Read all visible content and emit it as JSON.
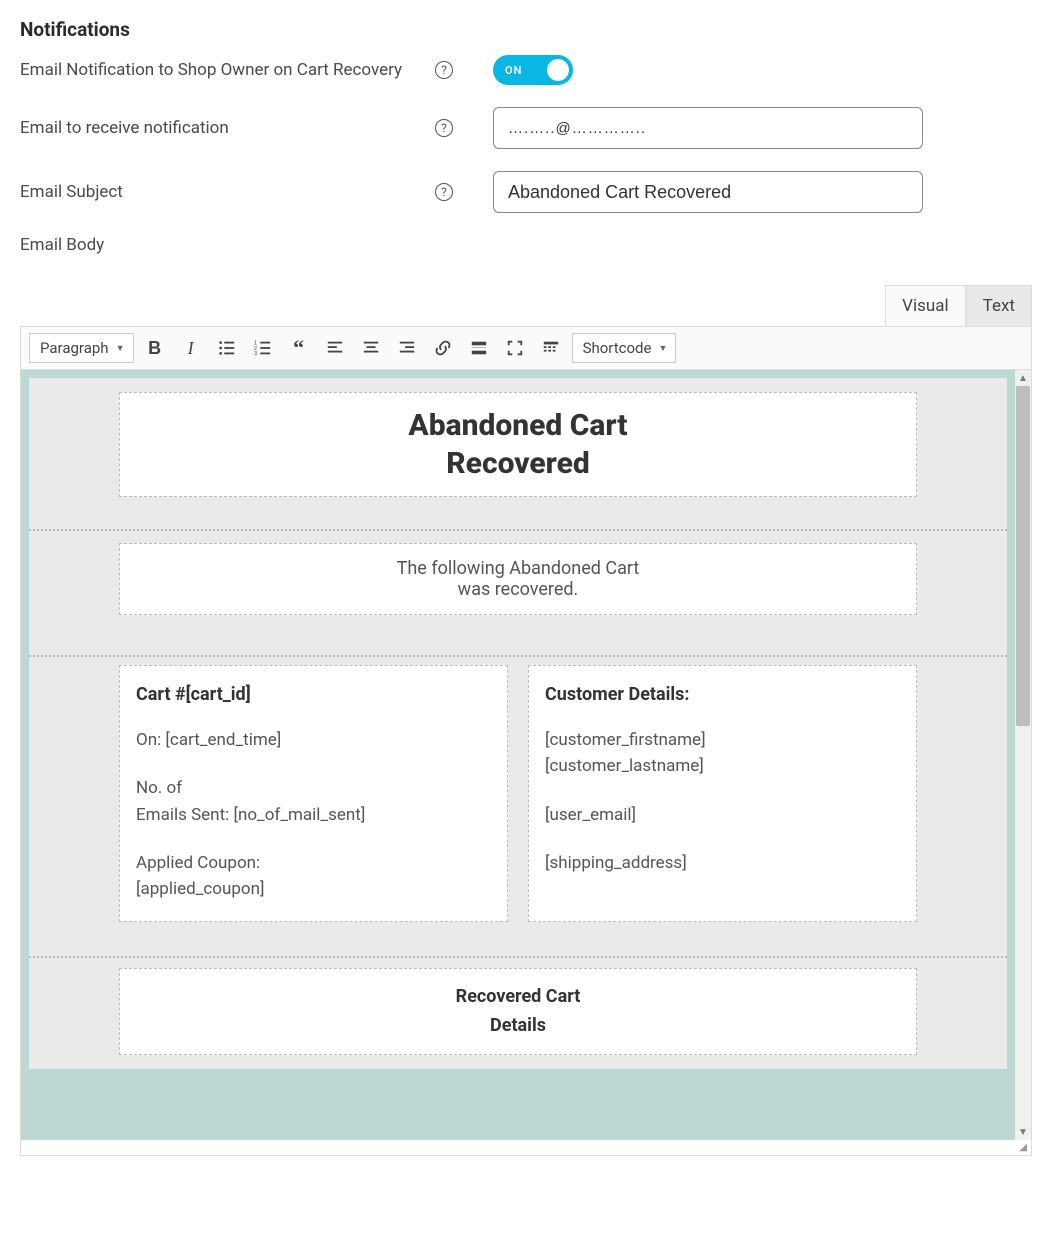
{
  "section_title": "Notifications",
  "rows": {
    "toggle_label": "Email Notification to Shop Owner on Cart Recovery",
    "toggle_state": "ON",
    "email_receive_label": "Email to receive notification",
    "email_receive_value": "….…..@…………..",
    "subject_label": "Email Subject",
    "subject_value": "Abandoned Cart Recovered",
    "body_label": "Email Body"
  },
  "tabs": {
    "visual": "Visual",
    "text": "Text"
  },
  "toolbar": {
    "style_dropdown": "Paragraph",
    "shortcode": "Shortcode"
  },
  "email_template": {
    "title_line1": "Abandoned Cart",
    "title_line2": "Recovered",
    "intro_line1": "The following Abandoned Cart",
    "intro_line2": "was recovered.",
    "cart_header": "Cart #[cart_id]",
    "cart_on": "On: [cart_end_time]",
    "cart_emails_l1": "No. of",
    "cart_emails_l2": "Emails Sent: [no_of_mail_sent]",
    "cart_coupon_l1": "Applied Coupon:",
    "cart_coupon_l2": "[applied_coupon]",
    "cust_header": "Customer Details:",
    "cust_first": "[customer_firstname]",
    "cust_last": "[customer_lastname]",
    "cust_email": "[user_email]",
    "cust_ship": "[shipping_address]",
    "rec_l1": "Recovered Cart",
    "rec_l2": "Details"
  }
}
